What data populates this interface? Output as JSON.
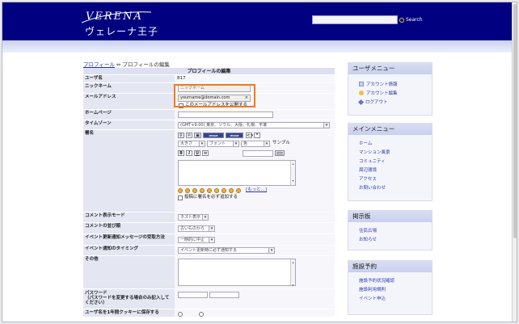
{
  "header": {
    "logo_en": "VERENA",
    "logo_jp": "ヴェレーナ王子",
    "search_button": "Search",
    "search_value": ""
  },
  "breadcrumb": {
    "profile": "プロフィール",
    "sep": " ⇔ ",
    "current": "プロフィールの編集"
  },
  "form": {
    "title": "プロフィールの編集",
    "user_name_label": "ユーザ名",
    "user_name_value": "817",
    "nickname_label": "ニックネーム",
    "nickname_value": "ニックネーム",
    "email_label": "メールアドレス",
    "email_value": "yourname@domain.com",
    "email_clear": "×",
    "email_public_label": "このメールアドレスを公開する",
    "homepage_label": "ホームページ",
    "timezone_label": "タイムゾーン",
    "timezone_value": "(GMT+9:00) 東京、ソウル、大阪、札幌、平壌",
    "signature_label": "署名",
    "size_value": "大きさ",
    "font_value": "フォント",
    "color_value": "色",
    "sample_label": "サンプル",
    "bold": "B",
    "italic": "I",
    "underline": "U",
    "strike": "ㅂ",
    "add_button": "追加",
    "more_link": "[もっと...]",
    "append_sig_label": "投稿に署名を必ず追加する",
    "comment_mode_label": "コメント表示モード",
    "comment_mode_value": "ネスト表示",
    "comment_order_label": "コメントの並び順",
    "comment_order_value": "古いものから",
    "event_msg_label": "イベント更新通知メッセージの受取方法",
    "event_msg_value": "一時的に中止",
    "event_timing_label": "イベント通知のタイミング",
    "event_timing_value": "イベント更新時に必ず通知する",
    "other_label": "その他",
    "password_label": "パスワード\n（パスワードを変更する場合のみ記入してください）",
    "cookie_label": "ユーザ名を1年間クッキーに保存する"
  },
  "sidebar": {
    "user_menu_title": "ユーザメニュー",
    "user_menu": [
      "アカウント情報",
      "アカウント編集",
      "ログアウト"
    ],
    "main_menu_title": "メインメニュー",
    "main_menu": [
      "ホーム",
      "マンション風景",
      "コミュニティ",
      "周辺環境",
      "アクセス",
      "お問い合わせ"
    ],
    "board_title": "掲示板",
    "board": [
      "住民広場",
      "お知らせ"
    ],
    "facility_title": "施設予約",
    "facility": [
      "施設予約状況確認",
      "施設利用規則",
      "イベント申込"
    ]
  },
  "colors": {
    "header_bg": "#000080",
    "highlight": "#f07a1e",
    "link": "#2a3aa8"
  }
}
